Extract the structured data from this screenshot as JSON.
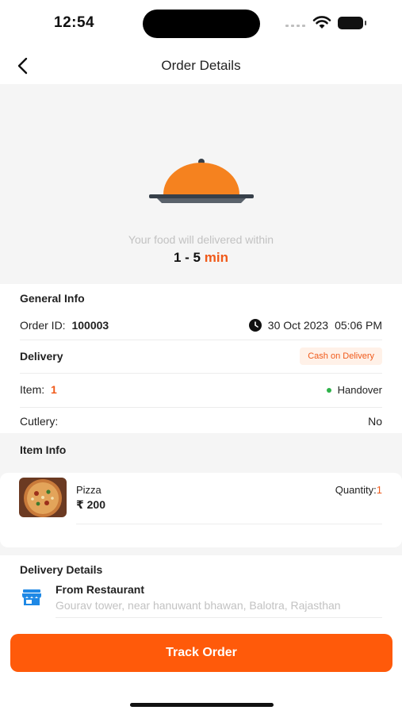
{
  "status_bar": {
    "time": "12:54"
  },
  "header": {
    "title": "Order Details"
  },
  "hero": {
    "subtitle": "Your food will delivered within",
    "time_range": "1 - 5",
    "time_unit": "min"
  },
  "general_info": {
    "title": "General Info",
    "order_id_label": "Order ID:",
    "order_id": "100003",
    "date": "30 Oct 2023",
    "time": "05:06 PM",
    "delivery_label": "Delivery",
    "payment_badge": "Cash on Delivery",
    "item_label": "Item:",
    "item_count": "1",
    "status": "Handover",
    "cutlery_label": "Cutlery:",
    "cutlery_value": "No"
  },
  "item_info": {
    "title": "Item Info",
    "items": [
      {
        "name": "Pizza",
        "price": "₹ 200",
        "quantity_label": "Quantity:",
        "quantity": "1"
      }
    ]
  },
  "delivery_details": {
    "title": "Delivery Details",
    "from_label": "From Restaurant",
    "address": "Gourav tower, near hanuwant bhawan, Balotra, Rajasthan"
  },
  "actions": {
    "track_order": "Track Order"
  },
  "colors": {
    "accent": "#ff5a0a",
    "accent_text": "#f05a1a",
    "status_green": "#2fb24a",
    "store_icon_blue": "#1e88e5"
  }
}
